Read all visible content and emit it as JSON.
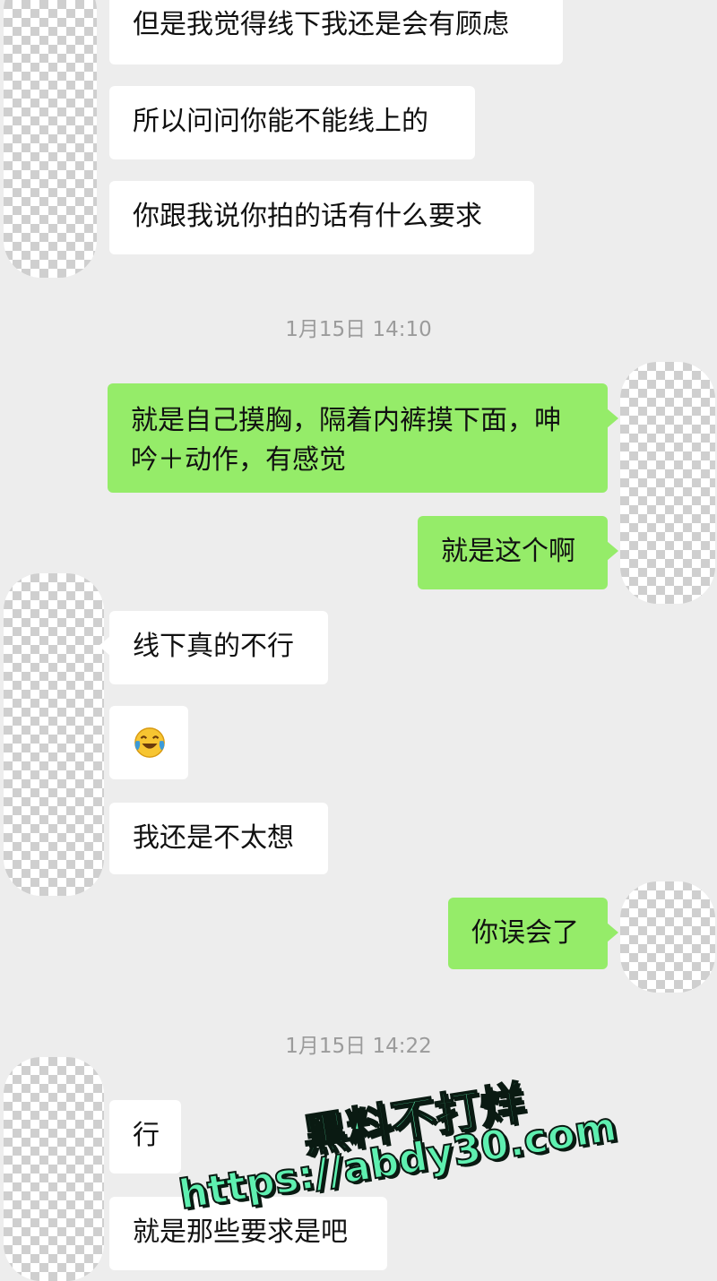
{
  "messages": {
    "m1": "但是我觉得线下我还是会有顾虑",
    "m2": "所以问问你能不能线上的",
    "m3": "你跟我说你拍的话有什么要求",
    "m4": "就是自己摸胸，隔着内裤摸下面，呻吟＋动作，有感觉",
    "m5": "就是这个啊",
    "m6": "线下真的不行",
    "m8": "我还是不太想",
    "m9": "你误会了",
    "m10": "行",
    "m11": "就是那些要求是吧"
  },
  "emoji_message": {
    "icon": "tears-of-joy-emoji-icon"
  },
  "timestamps": {
    "t1": "1月15日 14:10",
    "t2": "1月15日 14:22"
  },
  "watermark": {
    "line1": "黑料不打烊",
    "line2": "https://abdy30.com"
  },
  "colors": {
    "background": "#ededed",
    "incoming_bubble": "#ffffff",
    "outgoing_bubble": "#95ec69",
    "watermark": "#5ef0b0"
  }
}
